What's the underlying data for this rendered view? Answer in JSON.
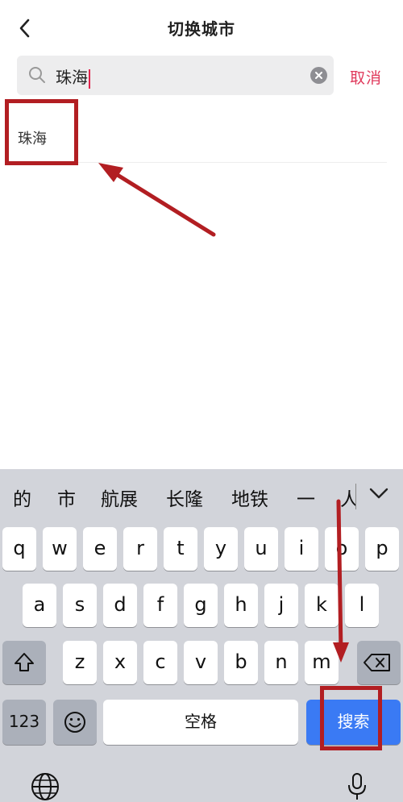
{
  "nav": {
    "title": "切换城市",
    "back_icon": "chevron-left-icon"
  },
  "search": {
    "value": "珠海",
    "cancel_label": "取消",
    "search_icon": "search-icon",
    "clear_icon": "clear-icon"
  },
  "results": [
    {
      "label": "珠海"
    }
  ],
  "keyboard": {
    "candidates": [
      "的",
      "市",
      "航展",
      "长隆",
      "地铁",
      "一",
      "人"
    ],
    "row1": [
      "q",
      "w",
      "e",
      "r",
      "t",
      "y",
      "u",
      "i",
      "o",
      "p"
    ],
    "row2": [
      "a",
      "s",
      "d",
      "f",
      "g",
      "h",
      "j",
      "k",
      "l"
    ],
    "row3": [
      "z",
      "x",
      "c",
      "v",
      "b",
      "n",
      "m"
    ],
    "numbers_label": "123",
    "space_label": "空格",
    "search_label": "搜索",
    "colors": {
      "search_key": "#3a7af4",
      "keyboard_bg": "#d2d4da"
    }
  },
  "annotation_color": "#b21e22"
}
